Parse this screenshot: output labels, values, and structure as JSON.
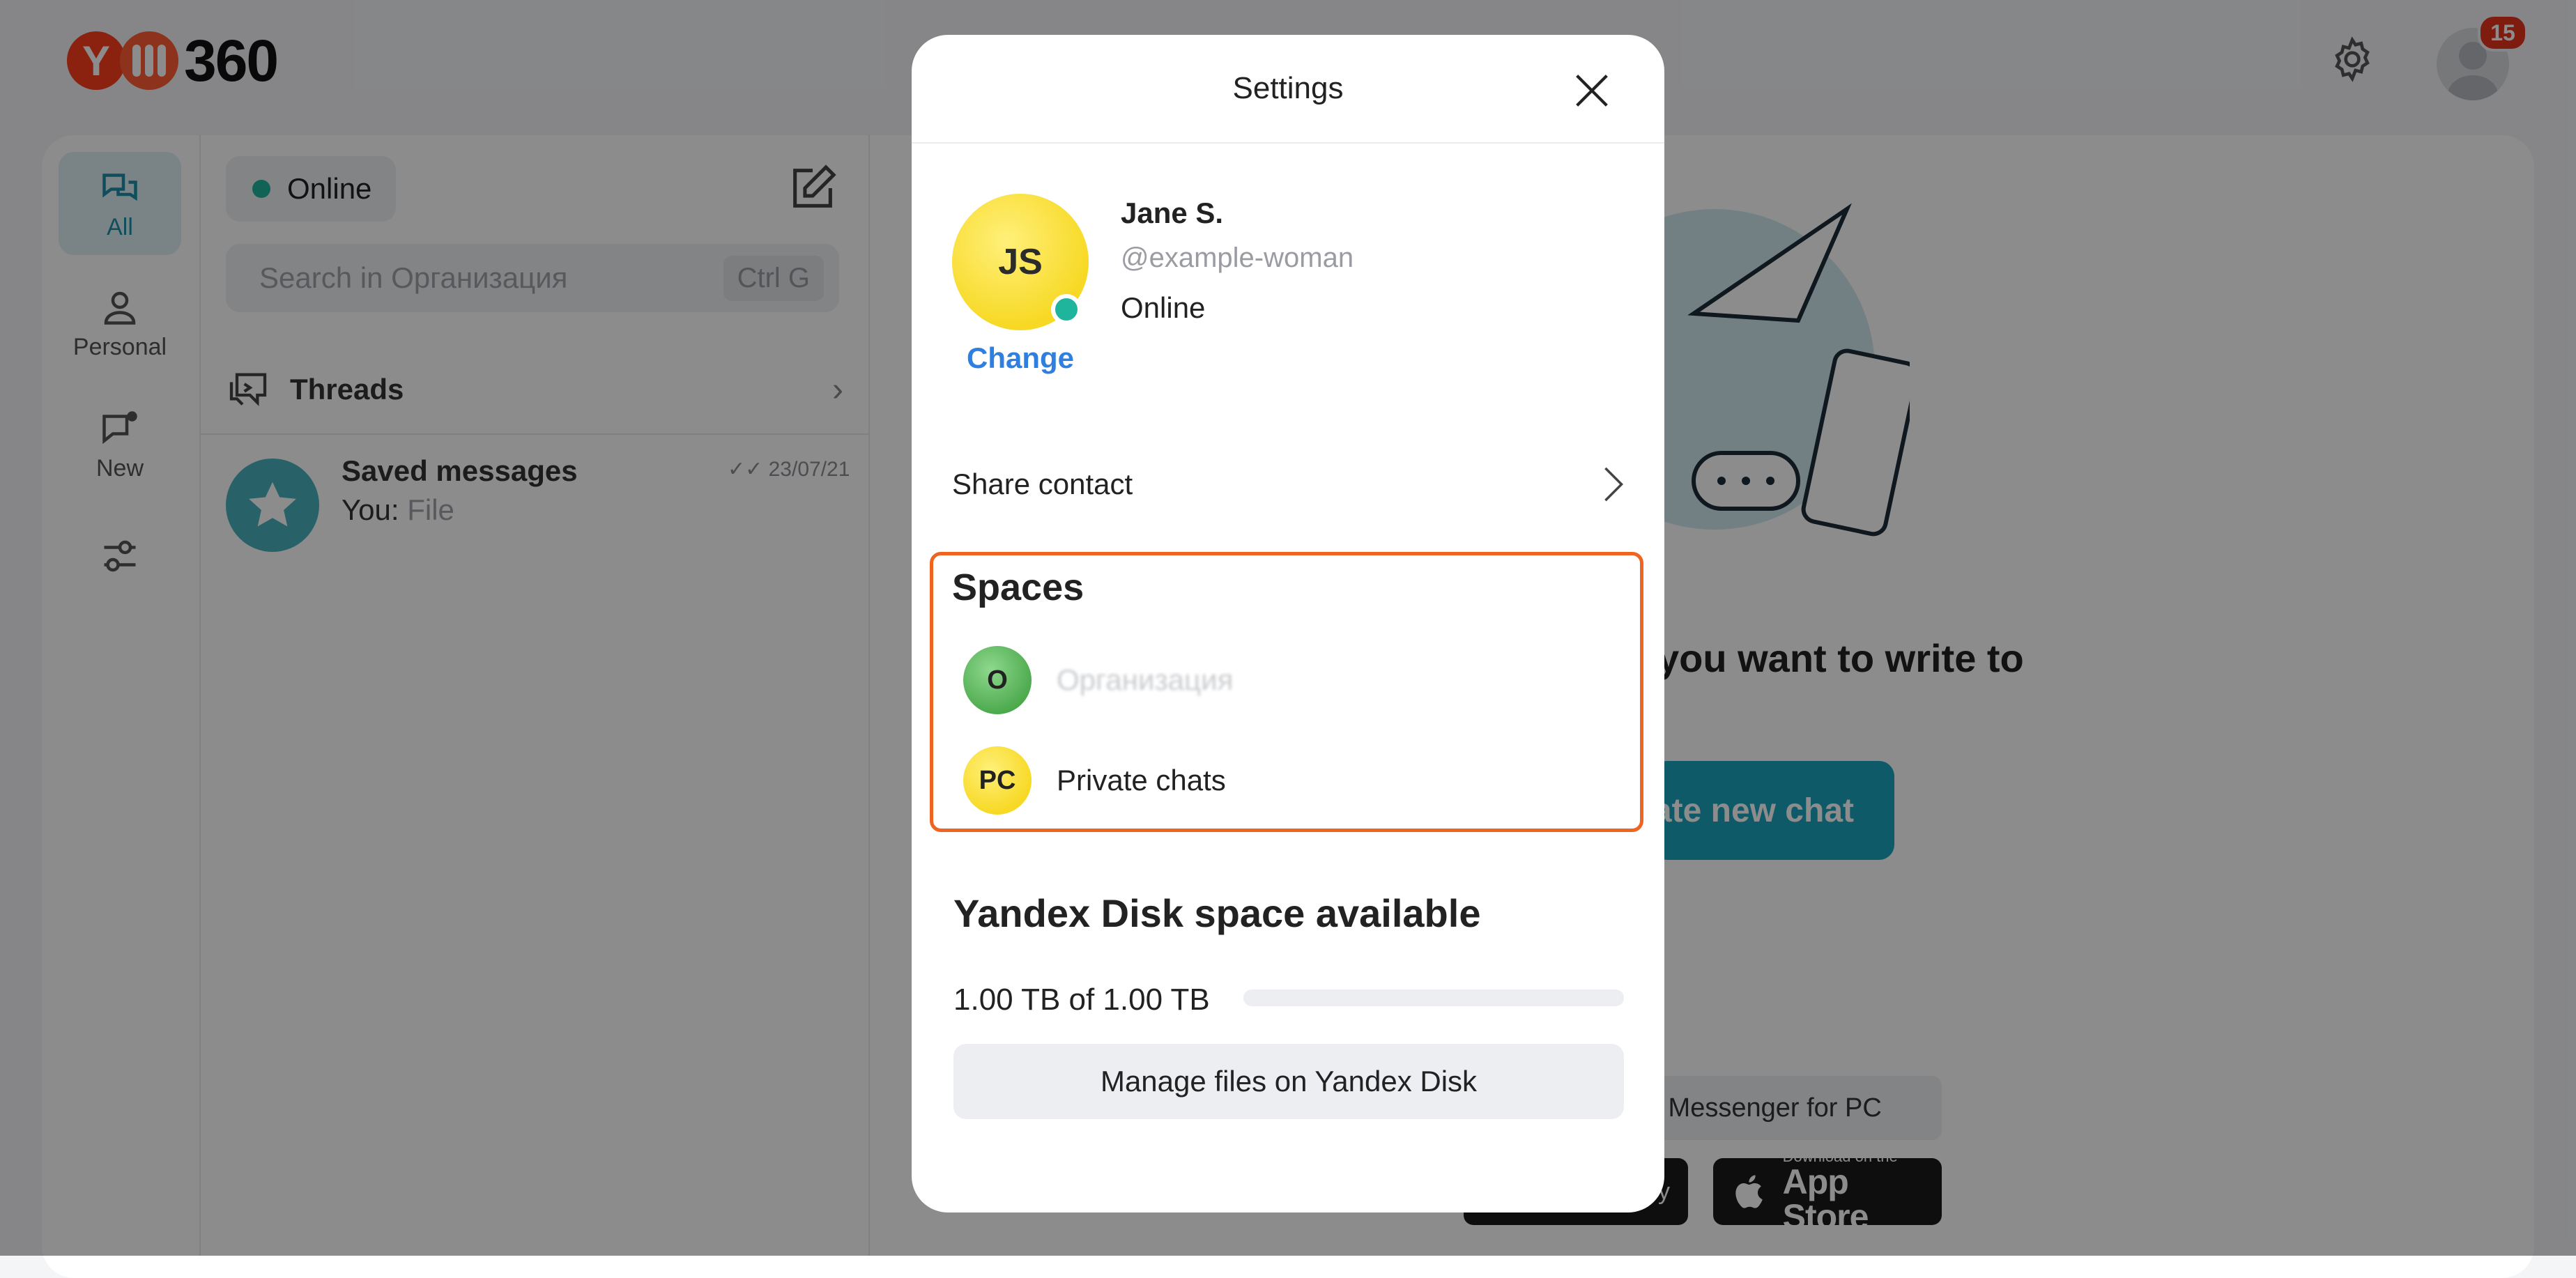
{
  "app": {
    "logo_text": "360",
    "notification_count": "15"
  },
  "nav": {
    "items": [
      {
        "label": "All",
        "active": true
      },
      {
        "label": "Personal"
      },
      {
        "label": "New"
      }
    ]
  },
  "chatlist": {
    "status": "Online",
    "search_placeholder": "Search in Организация",
    "search_shortcut": "Ctrl G",
    "threads_label": "Threads",
    "saved": {
      "title": "Saved messages",
      "prefix": "You:",
      "preview": "File",
      "date": "23/07/21"
    }
  },
  "main": {
    "cta_title": "you want to write to",
    "cta_button": "ate new chat",
    "download_pc": "x Messenger for PC",
    "google_play_text": "y",
    "appstore_small": "Download on the",
    "appstore_big": "App Store"
  },
  "modal": {
    "title": "Settings",
    "profile": {
      "initials": "JS",
      "change_link": "Change",
      "name": "Jane S.",
      "handle": "@example-woman",
      "status": "Online"
    },
    "share_contact": "Share contact",
    "spaces": {
      "title": "Spaces",
      "items": [
        {
          "initials": "O",
          "label": "Организация",
          "color": "#5cb85c"
        },
        {
          "initials": "PC",
          "label": "Private chats",
          "color": "#f7d925"
        }
      ]
    },
    "disk": {
      "title": "Yandex Disk space available",
      "amount": "1.00 TB of 1.00 TB",
      "used_fraction": 0.0,
      "manage_button": "Manage files on Yandex Disk"
    }
  },
  "colors": {
    "accent": "#1ca5bd",
    "highlight": "#f06421",
    "online": "#1fb59c",
    "link": "#2f7fe0"
  }
}
